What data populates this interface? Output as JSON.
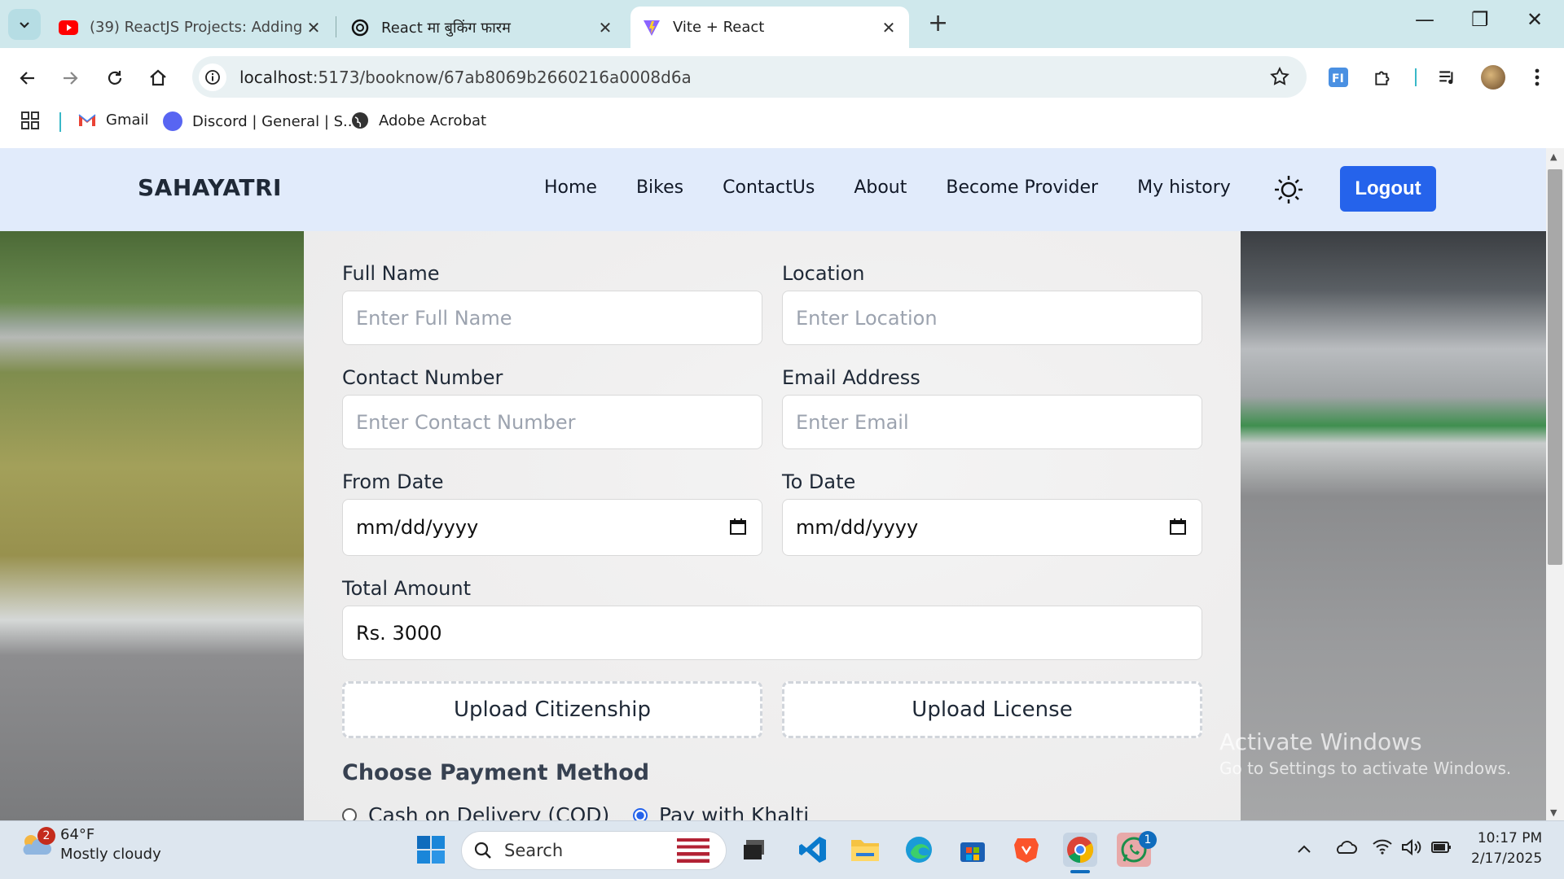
{
  "browser": {
    "tabs": [
      {
        "title": "(39) ReactJS Projects: Adding C",
        "icon": "youtube-icon"
      },
      {
        "title": "React मा बुकिंग फारम",
        "icon": "chatgpt-icon"
      },
      {
        "title": "Vite + React",
        "icon": "vite-icon"
      }
    ],
    "url_host": "localhost",
    "url_path": ":5173/booknow/67ab8069b2660216a0008d6a",
    "bookmarks": [
      "Gmail",
      "Discord | General | S...",
      "Adobe Acrobat"
    ]
  },
  "navbar": {
    "brand": "SAHAYATRI",
    "links": [
      "Home",
      "Bikes",
      "ContactUs",
      "About",
      "Become Provider",
      "My history"
    ],
    "logout": "Logout"
  },
  "form": {
    "full_name_label": "Full Name",
    "full_name_placeholder": "Enter Full Name",
    "location_label": "Location",
    "location_placeholder": "Enter Location",
    "contact_label": "Contact Number",
    "contact_placeholder": "Enter Contact Number",
    "email_label": "Email Address",
    "email_placeholder": "Enter Email",
    "from_date_label": "From Date",
    "from_date_value": "mm/dd/yyyy",
    "to_date_label": "To Date",
    "to_date_value": "mm/dd/yyyy",
    "total_label": "Total Amount",
    "total_value": "Rs. 3000",
    "upload_citizenship": "Upload Citizenship",
    "upload_license": "Upload License",
    "payment_title": "Choose Payment Method",
    "payment_options": [
      {
        "label": "Cash on Delivery (COD)",
        "selected": false
      },
      {
        "label": "Pay with Khalti",
        "selected": true
      }
    ]
  },
  "watermark": {
    "line1": "Activate Windows",
    "line2": "Go to Settings to activate Windows."
  },
  "taskbar": {
    "weather_temp": "64°F",
    "weather_desc": "Mostly cloudy",
    "weather_badge": "2",
    "search": "Search",
    "whatsapp_badge": "1",
    "time": "10:17 PM",
    "date": "2/17/2025"
  },
  "colors": {
    "accent": "#2563eb",
    "navbar_bg": "#e1ebfb",
    "tabbar_bg": "#cfe8ec"
  }
}
